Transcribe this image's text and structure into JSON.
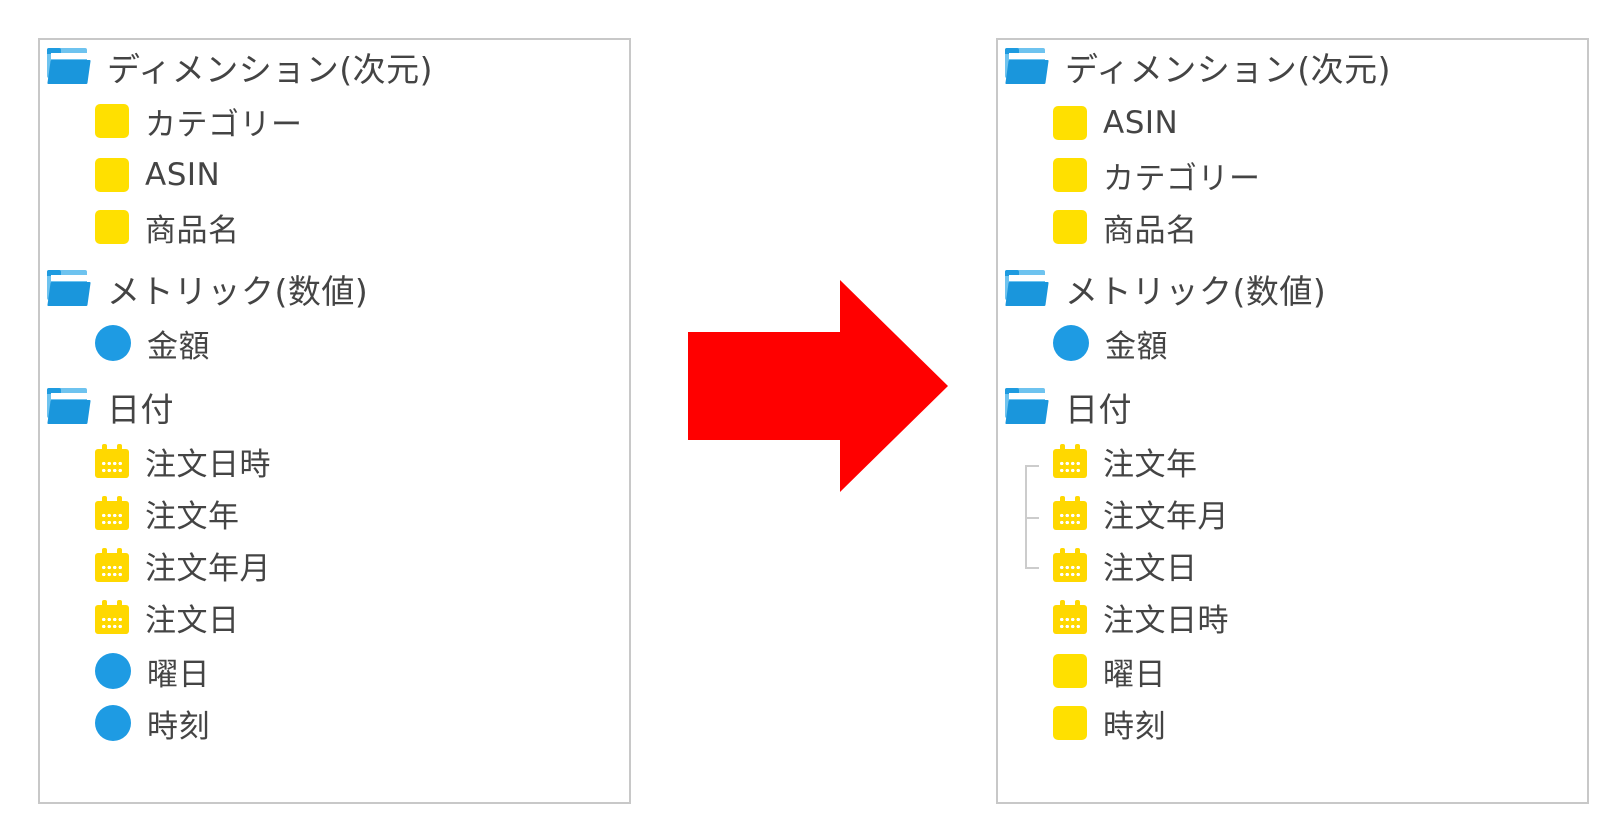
{
  "colors": {
    "folder_blue": "#1a96dc",
    "dimension_yellow": "#ffe000",
    "metric_blue": "#1e9be3",
    "calendar_yellow": "#ffd800",
    "arrow_red": "#ff0000",
    "panel_border": "#c8c8c8",
    "text": "#444444"
  },
  "left_panel": {
    "items": [
      {
        "kind": "folder",
        "icon": "folder-icon",
        "label": "ディメンション(次元)"
      },
      {
        "kind": "field",
        "icon": "square-icon",
        "label": "カテゴリー"
      },
      {
        "kind": "field",
        "icon": "square-icon",
        "label": "ASIN"
      },
      {
        "kind": "field",
        "icon": "square-icon",
        "label": "商品名"
      },
      {
        "kind": "folder",
        "icon": "folder-icon",
        "label": "メトリック(数値)"
      },
      {
        "kind": "field",
        "icon": "circle-icon",
        "label": "金額"
      },
      {
        "kind": "folder",
        "icon": "folder-icon",
        "label": "日付"
      },
      {
        "kind": "field",
        "icon": "calendar-icon",
        "label": "注文日時"
      },
      {
        "kind": "field",
        "icon": "calendar-icon",
        "label": "注文年"
      },
      {
        "kind": "field",
        "icon": "calendar-icon",
        "label": "注文年月"
      },
      {
        "kind": "field",
        "icon": "calendar-icon",
        "label": "注文日"
      },
      {
        "kind": "field",
        "icon": "circle-icon",
        "label": "曜日"
      },
      {
        "kind": "field",
        "icon": "circle-icon",
        "label": "時刻"
      }
    ]
  },
  "arrow": {
    "icon": "right-arrow-icon",
    "color": "#ff0000"
  },
  "right_panel": {
    "items": [
      {
        "kind": "folder",
        "icon": "folder-icon",
        "label": "ディメンション(次元)"
      },
      {
        "kind": "field",
        "icon": "square-icon",
        "label": "ASIN"
      },
      {
        "kind": "field",
        "icon": "square-icon",
        "label": "カテゴリー"
      },
      {
        "kind": "field",
        "icon": "square-icon",
        "label": "商品名"
      },
      {
        "kind": "folder",
        "icon": "folder-icon",
        "label": "メトリック(数値)"
      },
      {
        "kind": "field",
        "icon": "circle-icon",
        "label": "金額"
      },
      {
        "kind": "folder",
        "icon": "folder-icon",
        "label": "日付"
      },
      {
        "kind": "field",
        "icon": "calendar-icon",
        "label": "注文年"
      },
      {
        "kind": "field",
        "icon": "calendar-icon",
        "label": "注文年月"
      },
      {
        "kind": "field",
        "icon": "calendar-icon",
        "label": "注文日"
      },
      {
        "kind": "field",
        "icon": "calendar-icon",
        "label": "注文日時"
      },
      {
        "kind": "field",
        "icon": "square-icon",
        "label": "曜日"
      },
      {
        "kind": "field",
        "icon": "square-icon",
        "label": "時刻"
      }
    ]
  }
}
